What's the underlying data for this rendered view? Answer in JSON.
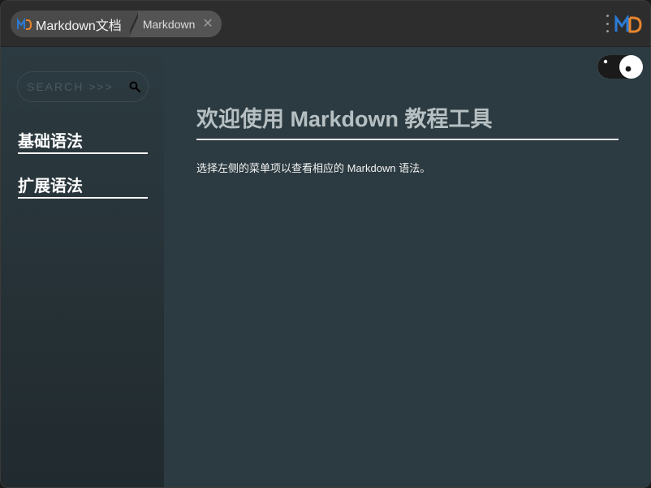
{
  "titlebar": {
    "tab_main_label": "Markdown文档",
    "tab_second_label": "Markdown",
    "close_glyph": "✕",
    "colors": {
      "logo_blue": "#2b7bd6",
      "logo_orange": "#e8852c"
    }
  },
  "sidebar": {
    "search": {
      "placeholder": "SEARCH >>>",
      "value": ""
    },
    "items": [
      {
        "label": "基础语法"
      },
      {
        "label": "扩展语法"
      }
    ]
  },
  "main": {
    "title": "欢迎使用 Markdown 教程工具",
    "description": "选择左侧的菜单项以查看相应的 Markdown 语法。"
  },
  "icons": {
    "search": "search-icon",
    "menu": "kebab-menu-icon",
    "logo": "md-logo-icon",
    "theme_toggle": "yin-yang-toggle-icon"
  },
  "colors": {
    "background": "#2c3b41",
    "titlebar": "#2d2d2d",
    "heading": "#b6c0c3",
    "text": "#f2f2f2"
  }
}
